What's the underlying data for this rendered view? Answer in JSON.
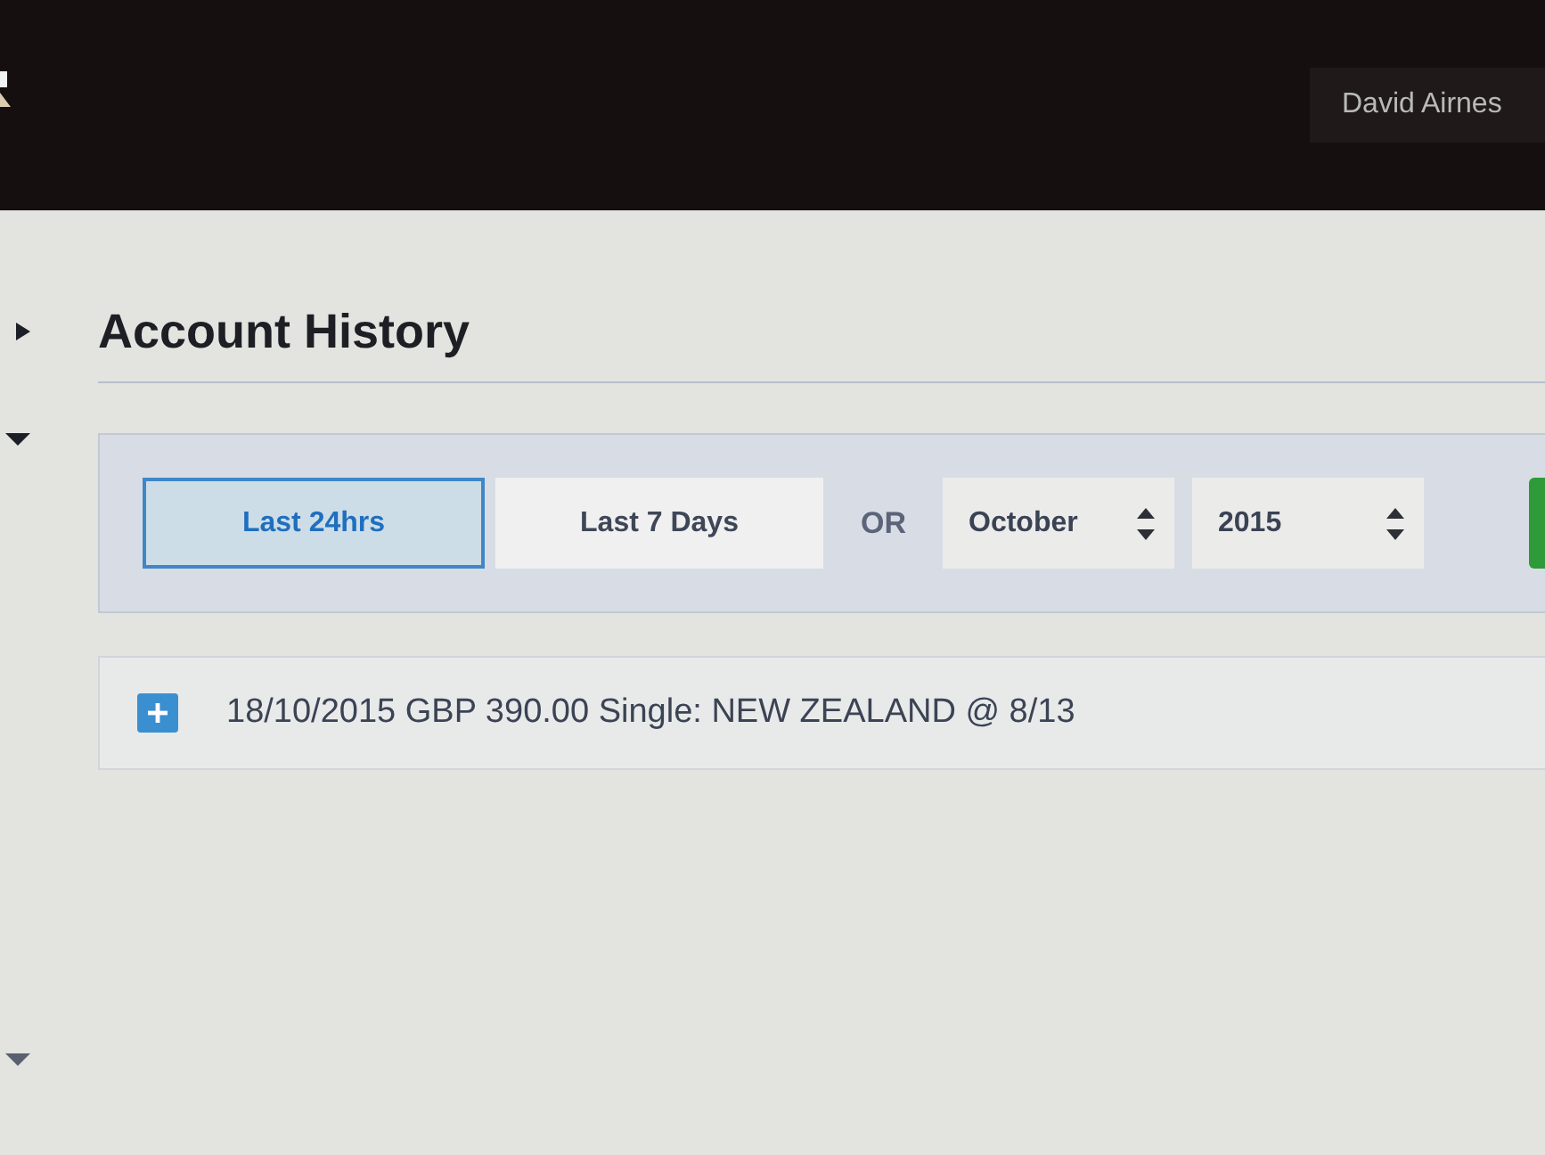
{
  "header": {
    "user_name": "David Airnes"
  },
  "sidebar": {
    "toggles": [
      {
        "expanded": false
      },
      {
        "expanded": true
      },
      {
        "expanded": true
      }
    ]
  },
  "page": {
    "title": "Account History"
  },
  "filters": {
    "periods": [
      {
        "label": "Last 24hrs",
        "selected": true
      },
      {
        "label": "Last 7 Days",
        "selected": false
      }
    ],
    "separator": "OR",
    "month": {
      "value": "October"
    },
    "year": {
      "value": "2015"
    }
  },
  "results": [
    {
      "text": "18/10/2015 GBP 390.00 Single: NEW ZEALAND @ 8/13",
      "expanded": false
    }
  ]
}
